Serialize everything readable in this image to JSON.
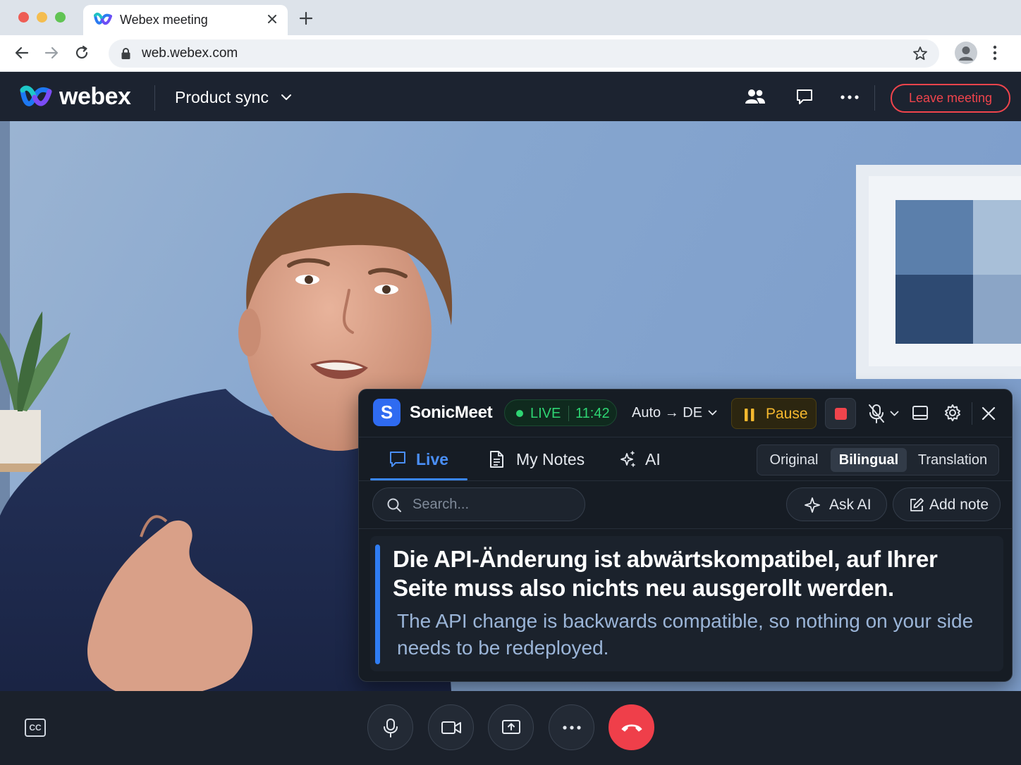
{
  "browser": {
    "tab_title": "Webex meeting",
    "url": "web.webex.com",
    "icons": [
      "webex-favicon-icon",
      "close-icon",
      "plus-icon",
      "back-arrow-icon",
      "forward-arrow-icon",
      "reload-icon",
      "lock-icon",
      "star-icon",
      "profile-icon",
      "kebab-menu-icon"
    ]
  },
  "webex": {
    "brand": "webex",
    "meeting_title": "Product sync",
    "leave_label": "Leave meeting",
    "accent_color": "#f0444c",
    "icons": [
      "participants-icon",
      "chat-icon",
      "more-icon"
    ]
  },
  "sonicmeet": {
    "logo_letter": "S",
    "name": "SonicMeet",
    "live_label": "LIVE",
    "elapsed": "11:42",
    "language": "Auto → DE",
    "pause_label": "Pause",
    "tabs": [
      {
        "label": "Live",
        "icon": "chat-bubble-icon",
        "active": true
      },
      {
        "label": "My Notes",
        "icon": "document-icon",
        "active": false
      },
      {
        "label": "AI",
        "icon": "sparkle-icon",
        "active": false
      }
    ],
    "view_modes": [
      {
        "label": "Original",
        "active": false
      },
      {
        "label": "Bilingual",
        "active": true
      },
      {
        "label": "Translation",
        "active": false
      }
    ],
    "search_placeholder": "Search...",
    "ask_ai_label": "Ask AI",
    "add_note_label": "Add note",
    "caption": {
      "original": "Die API-Änderung ist abwärtskompatibel, auf Ihrer Seite muss also nichts neu ausgerollt werden.",
      "translation": "The API change is backwards compatible, so nothing on your side needs to be redeployed."
    },
    "colors": {
      "live": "#2ed573",
      "pause": "#f5b82e",
      "stop": "#f0444c",
      "accent": "#2f7df4"
    }
  },
  "controls": {
    "cc_label": "CC",
    "icons": [
      "microphone-icon",
      "video-camera-icon",
      "share-screen-icon",
      "more-icon",
      "end-call-icon"
    ],
    "end_call_color": "#ef3f4a"
  }
}
